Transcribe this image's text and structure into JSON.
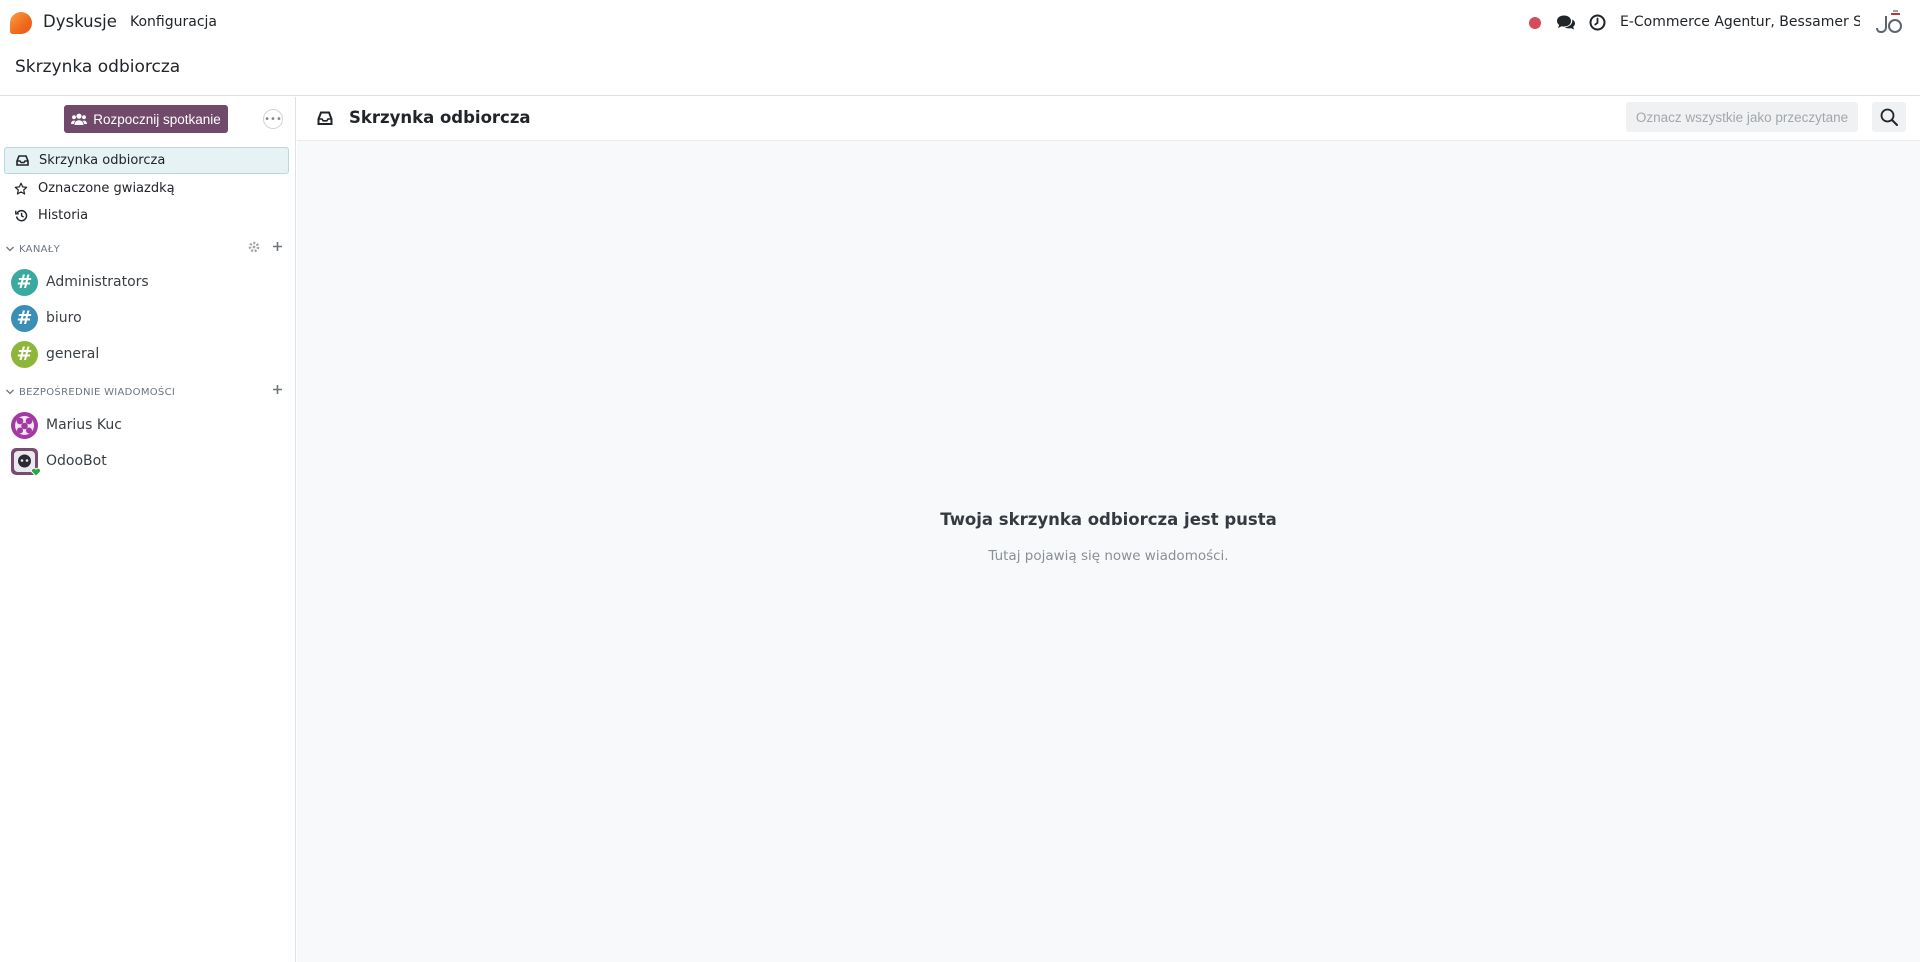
{
  "navbar": {
    "app_name": "Dyskusje",
    "menu_config": "Konfiguracja",
    "company": "E-Commerce Agentur, Bessamer Str...",
    "colors": {
      "logo": "#f06a1d",
      "rec_dot": "#d44c59"
    }
  },
  "control_panel": {
    "breadcrumb": "Skrzynka odbiorcza"
  },
  "sidebar": {
    "start_meeting": "Rozpocznij spotkanie",
    "mailboxes": [
      {
        "label": "Skrzynka odbiorcza",
        "icon": "inbox-icon",
        "active": true
      },
      {
        "label": "Oznaczone gwiazdką",
        "icon": "star-icon",
        "active": false
      },
      {
        "label": "Historia",
        "icon": "history-icon",
        "active": false
      }
    ],
    "channels_header": "KANAŁY",
    "channels": [
      {
        "name": "Administrators",
        "color": "#3aa99f"
      },
      {
        "name": "biuro",
        "color": "#3a8fb7"
      },
      {
        "name": "general",
        "color": "#8db63a"
      }
    ],
    "dm_header": "BEZPOŚREDNIE WIADOMOŚCI",
    "direct_messages": [
      {
        "name": "Marius Kuc",
        "icon": "user-avatar-icon"
      },
      {
        "name": "OdooBot",
        "icon": "odoobot-avatar-icon"
      }
    ],
    "button_color": "#71496a"
  },
  "main": {
    "title": "Skrzynka odbiorcza",
    "mark_all_read": "Oznacz wszystkie jako przeczytane",
    "empty_title": "Twoja skrzynka odbiorcza jest pusta",
    "empty_subtitle": "Tutaj pojawią się nowe wiadomości."
  }
}
